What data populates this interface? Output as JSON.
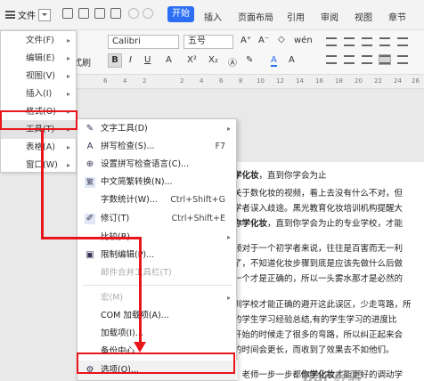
{
  "topbar": {
    "file_label": "文件",
    "start_tab": "开始",
    "tabs": [
      "插入",
      "页面布局",
      "引用",
      "审阅",
      "视图",
      "章节"
    ]
  },
  "ribbon": {
    "font_name": "Calibri",
    "font_size": "五号",
    "style_label": "式刷",
    "bold": "B",
    "italic": "I",
    "underline": "U",
    "font_grow": "A⁺",
    "font_shrink": "A⁻",
    "superscript": "X²",
    "subscript": "X₂",
    "font_color": "A"
  },
  "ruler": [
    "6",
    "4",
    "2",
    "2",
    "4",
    "6",
    "8",
    "10",
    "12",
    "14",
    "16",
    "18",
    "20",
    "22",
    "24",
    "26"
  ],
  "file_menu": [
    {
      "label": "文件(F)",
      "has_sub": true
    },
    {
      "label": "编辑(E)",
      "has_sub": true
    },
    {
      "label": "视图(V)",
      "has_sub": true
    },
    {
      "label": "插入(I)",
      "has_sub": true
    },
    {
      "label": "格式(O)",
      "has_sub": true
    },
    {
      "label": "工具(T)",
      "has_sub": true
    },
    {
      "label": "表格(A)",
      "has_sub": true
    },
    {
      "label": "窗口(W)",
      "has_sub": true
    }
  ],
  "tools_menu": [
    {
      "label": "文字工具(D)",
      "icon": "text-tool-icon",
      "glyph": "✎",
      "has_sub": true
    },
    {
      "label": "拼写检查(S)...",
      "icon": "spellcheck-icon",
      "glyph": "A",
      "shortcut": "F7"
    },
    {
      "label": "设置拼写检查语言(C)...",
      "icon": "language-icon",
      "glyph": "⊕"
    },
    {
      "label": "中文简繁转换(N)...",
      "icon": "convert-icon",
      "glyph": "繁"
    },
    {
      "label": "字数统计(W)...",
      "icon": "",
      "glyph": "",
      "shortcut": "Ctrl+Shift+G"
    },
    {
      "label": "修订(T)",
      "icon": "revision-icon",
      "glyph": "✐",
      "shortcut": "Ctrl+Shift+E"
    },
    {
      "label": "比较(B)",
      "icon": "",
      "glyph": "",
      "has_sub": true
    },
    {
      "label": "限制编辑(P)...",
      "icon": "restrict-icon",
      "glyph": "▣"
    },
    {
      "label": "邮件合并工具栏(T)",
      "icon": "",
      "glyph": "",
      "disabled": true
    },
    {
      "label": "宏(M)",
      "icon": "",
      "glyph": "",
      "has_sub": true,
      "disabled": true
    },
    {
      "label": "COM 加载项(A)...",
      "icon": "",
      "glyph": ""
    },
    {
      "label": "加载项(I)...",
      "icon": "",
      "glyph": ""
    },
    {
      "label": "备份中心",
      "icon": "",
      "glyph": ""
    },
    {
      "label": "选项(O)...",
      "icon": "gear-icon",
      "glyph": "⚙"
    }
  ],
  "doc": {
    "line1_pre": "学化妆",
    "line1_post": "，直到你学会为止",
    "line2": "关于数化妆的视频，看上去没有什么不对，但",
    "line3": "学者误入歧途。黑光教育化妆培训机构提醒大",
    "line4_bold": "你学化妆",
    "line4_post": "，直到你学会为止的专业学校，才能",
    "line5": "频对于一个初学者来说，往往是百害而无一利",
    "line6": "了，不知道化妆步骤到底是应该先做什么后做",
    "line7": "一个才是正确的，所以一头雾水那才是必然的",
    "line8": "训学校才能正确的避开这此误区，少走弯路，所",
    "line9": "的学生学习经验总结,有的学生学习的进度比",
    "line10": "开始的时候走了很多的弯路，所以纠正起来会",
    "line11": "的时间会更长，而收到了效果去不如他们。",
    "line12_pre": "，老师一步一步都",
    "line12_bold": "你学化妆",
    "line12_post": "才能更好的调动学"
  },
  "watermark": "Bai 经验"
}
